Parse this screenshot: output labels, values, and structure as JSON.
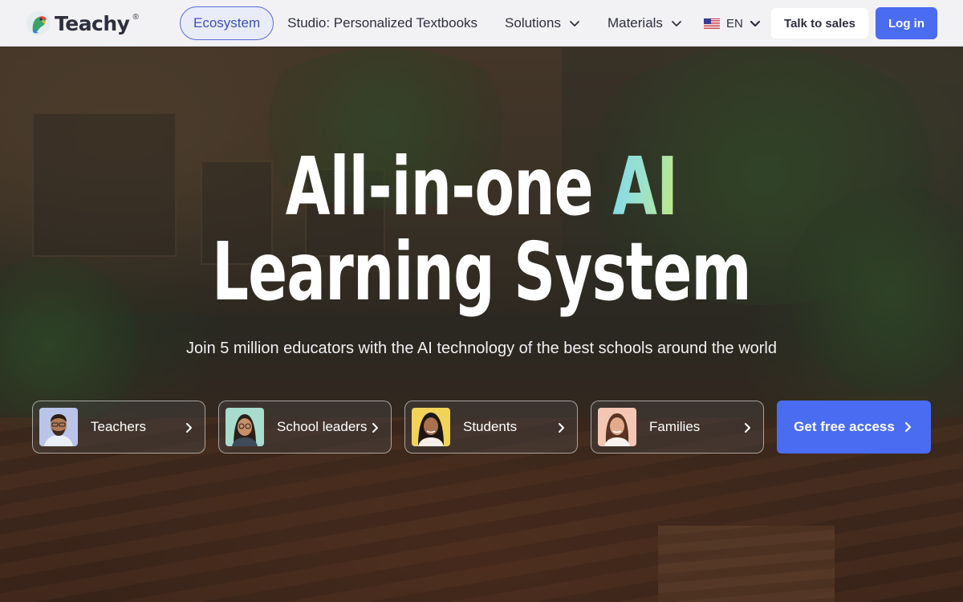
{
  "header": {
    "logo_text": "Teachy",
    "logo_reg": "®",
    "nav": [
      {
        "label": "Ecosystem"
      },
      {
        "label": "Studio: Personalized Textbooks"
      },
      {
        "label": "Solutions"
      },
      {
        "label": "Materials"
      }
    ],
    "language": "EN",
    "talk_to_sales": "Talk to sales",
    "login": "Log in"
  },
  "hero": {
    "title_part1": "All-in-one",
    "title_highlight": "AI",
    "title_line2": "Learning System",
    "subtitle": "Join 5 million educators with the AI technology of the best schools around the world",
    "highlight_gradient": [
      "#7fd8ef",
      "#9ee3c8",
      "#c3e87a"
    ]
  },
  "audiences": [
    {
      "label": "Teachers"
    },
    {
      "label": "School leaders"
    },
    {
      "label": "Students"
    },
    {
      "label": "Families"
    }
  ],
  "cta": {
    "label": "Get free access"
  },
  "colors": {
    "accent": "#4a6cf0",
    "header_bg": "#f2f2f4",
    "nav_active_border": "#5c6bd6",
    "text_dark": "#2e2f3e"
  },
  "icons": [
    "teachy-parrot-logo",
    "chevron-down-icon",
    "us-flag-icon",
    "chevron-right-icon"
  ]
}
